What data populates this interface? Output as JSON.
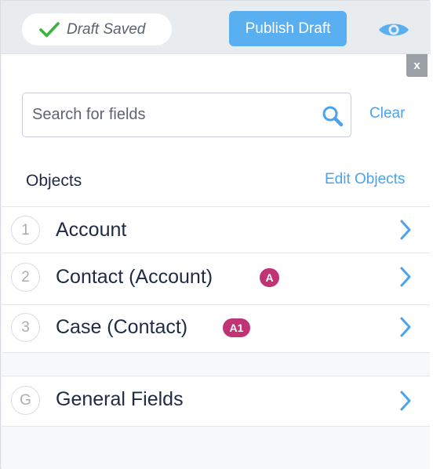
{
  "header": {
    "draft_status": "Draft Saved",
    "publish_label": "Publish Draft",
    "preview_icon": "eye-icon"
  },
  "close_label": "x",
  "search": {
    "placeholder": "Search for fields",
    "value": "",
    "clear_label": "Clear"
  },
  "objects": {
    "title": "Objects",
    "edit_label": "Edit Objects",
    "items": [
      {
        "index": "1",
        "label": "Account",
        "badge": ""
      },
      {
        "index": "2",
        "label": "Contact (Account)",
        "badge": "A"
      },
      {
        "index": "3",
        "label": "Case (Contact)",
        "badge": "A1"
      }
    ]
  },
  "general": {
    "index": "G",
    "label": "General Fields"
  },
  "colors": {
    "accent": "#5aaff0",
    "link": "#4aa3ec",
    "badge": "#c03374",
    "check": "#3cb043"
  }
}
